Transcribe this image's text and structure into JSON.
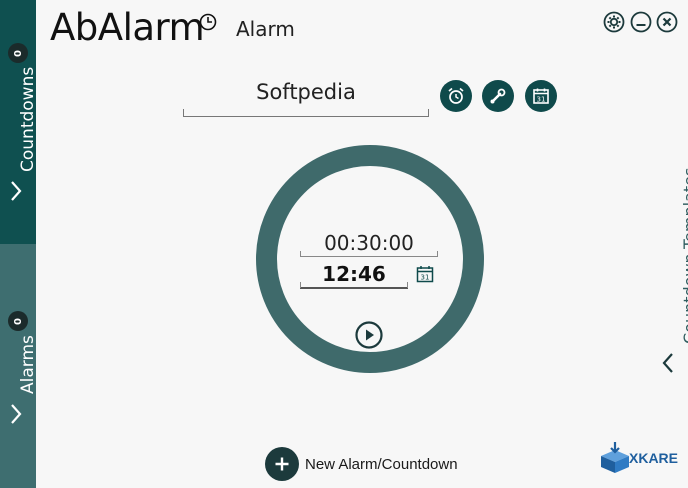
{
  "app": {
    "title": "AbAlarm",
    "subtitle": "Alarm"
  },
  "sidebar": {
    "countdowns": {
      "label": "Countdowns",
      "count": "0"
    },
    "alarms": {
      "label": "Alarms",
      "count": "0"
    }
  },
  "window_controls": {
    "icons": [
      "gear-icon",
      "minimize-icon",
      "close-icon"
    ]
  },
  "alarm": {
    "name": "Softpedia",
    "duration": "00:30:00",
    "time": "12:46"
  },
  "toolbar": {
    "icons": [
      "alarm-clock-icon",
      "wrench-icon",
      "calendar-icon"
    ],
    "calendar_day": "31"
  },
  "footer": {
    "new_button_label": "New Alarm/Countdown"
  },
  "templates_panel": {
    "label": "Countdown-Templates"
  },
  "vendor": {
    "logo_text": "XKARE"
  },
  "colors": {
    "sidebar_dark": "#0f5050",
    "sidebar_light": "#3e6e70",
    "ring": "#3f6a6b",
    "button": "#0f4a4b",
    "background": "#f7f7f7"
  }
}
